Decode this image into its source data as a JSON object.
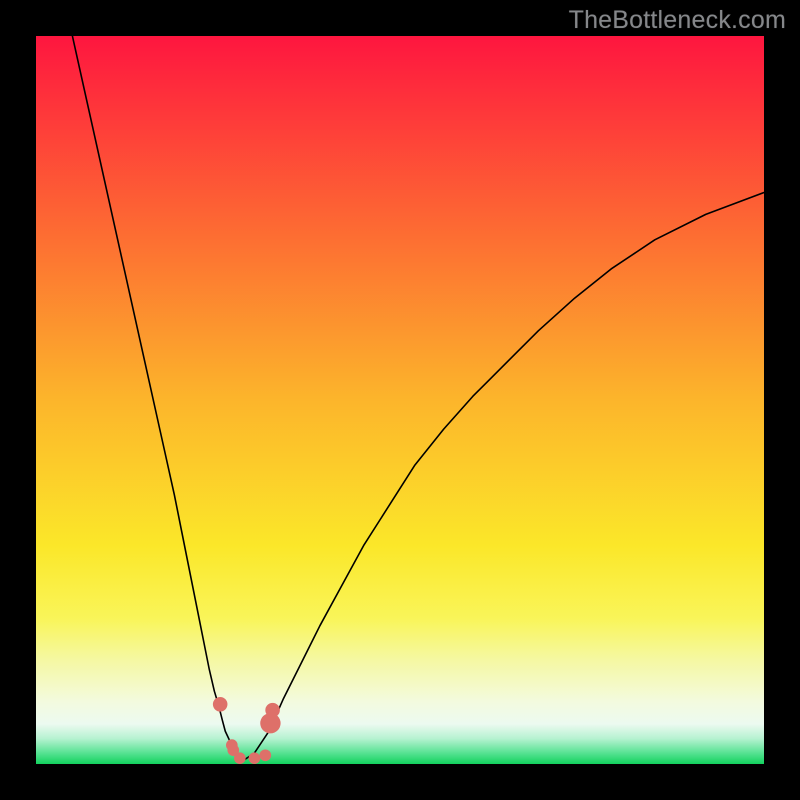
{
  "watermark": "TheBottleneck.com",
  "chart_data": {
    "type": "line",
    "title": "",
    "xlabel": "",
    "ylabel": "",
    "xlim": [
      0,
      100
    ],
    "ylim": [
      0,
      100
    ],
    "grid": false,
    "legend": false,
    "background_gradient": {
      "top": "#fe163f",
      "upper_mid": "#fe9929",
      "mid": "#fbe729",
      "lower_mid": "#eef89e",
      "bottom": "#1ad664"
    },
    "notes": "Two black curves rendered over a vertical red→green gradient. Left curve rises steeply from bottom (~x≈28,y=0) toward top-left; right curve rises gently from bottom (~x≈28,y=0) to top-right. A few salmon markers cluster near the trough. Values are approximate, read from pixel geometry; chart has no axes, ticks or numeric labels.",
    "series": [
      {
        "name": "left-curve",
        "x": [
          5,
          7,
          9,
          11,
          13,
          15,
          17,
          19,
          20,
          21,
          22,
          23,
          23.8,
          24.5,
          25.1,
          25.6,
          26.0,
          27.4,
          28.5
        ],
        "y": [
          100,
          91,
          82,
          73,
          64,
          55,
          46,
          37,
          32,
          27,
          22,
          17,
          13,
          10,
          8,
          6,
          4.5,
          1.5,
          0.5
        ]
      },
      {
        "name": "right-curve",
        "x": [
          28.5,
          30,
          32,
          34,
          36.5,
          39,
          42,
          45,
          48.5,
          52,
          56,
          60,
          64.5,
          69,
          74,
          79,
          85,
          92,
          100
        ],
        "y": [
          0.5,
          1.5,
          4.5,
          9,
          14,
          19,
          24.5,
          30,
          35.5,
          41,
          46,
          50.5,
          55,
          59.5,
          64,
          68,
          72,
          75.5,
          78.5
        ]
      }
    ],
    "markers": [
      {
        "x": 25.3,
        "y": 8.2,
        "r": 1.0,
        "color": "#de7069"
      },
      {
        "x": 26.9,
        "y": 2.6,
        "r": 0.8,
        "color": "#de7069"
      },
      {
        "x": 27.1,
        "y": 1.9,
        "r": 0.8,
        "color": "#de7069"
      },
      {
        "x": 28.0,
        "y": 0.8,
        "r": 0.8,
        "color": "#de7069"
      },
      {
        "x": 30.0,
        "y": 0.8,
        "r": 0.8,
        "color": "#de7069"
      },
      {
        "x": 31.5,
        "y": 1.2,
        "r": 0.8,
        "color": "#de7069"
      },
      {
        "x": 32.2,
        "y": 5.6,
        "r": 1.4,
        "color": "#de7069"
      },
      {
        "x": 32.5,
        "y": 7.4,
        "r": 1.0,
        "color": "#de7069"
      }
    ]
  }
}
